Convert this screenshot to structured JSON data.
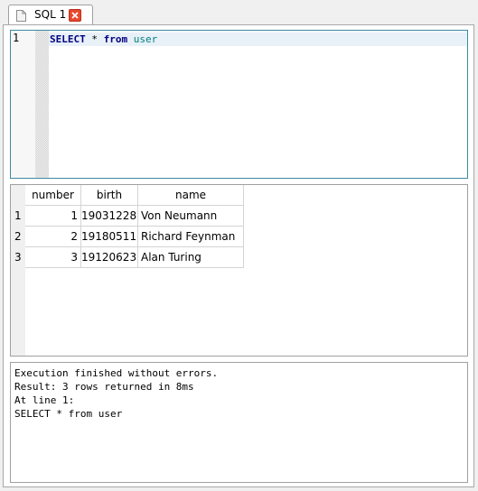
{
  "tab": {
    "label": "SQL 1"
  },
  "editor": {
    "line_numbers": [
      "1"
    ],
    "code": {
      "kw_select": "SELECT",
      "star": "*",
      "kw_from": "from",
      "table": "user"
    }
  },
  "results": {
    "columns": [
      "number",
      "birth",
      "name"
    ],
    "rows": [
      {
        "index": "1",
        "number": "1",
        "birth": "19031228",
        "name": "Von Neumann"
      },
      {
        "index": "2",
        "number": "2",
        "birth": "19180511",
        "name": "Richard Feynman"
      },
      {
        "index": "3",
        "number": "3",
        "birth": "19120623",
        "name": "Alan Turing"
      }
    ]
  },
  "log": {
    "lines": [
      "Execution finished without errors.",
      "Result: 3 rows returned in 8ms",
      "At line 1:",
      "SELECT * from user"
    ]
  },
  "colors": {
    "accent_border": "#3a8ba0",
    "keyword": "#00007f",
    "identifier": "#008080",
    "close_button": "#e8482c"
  }
}
